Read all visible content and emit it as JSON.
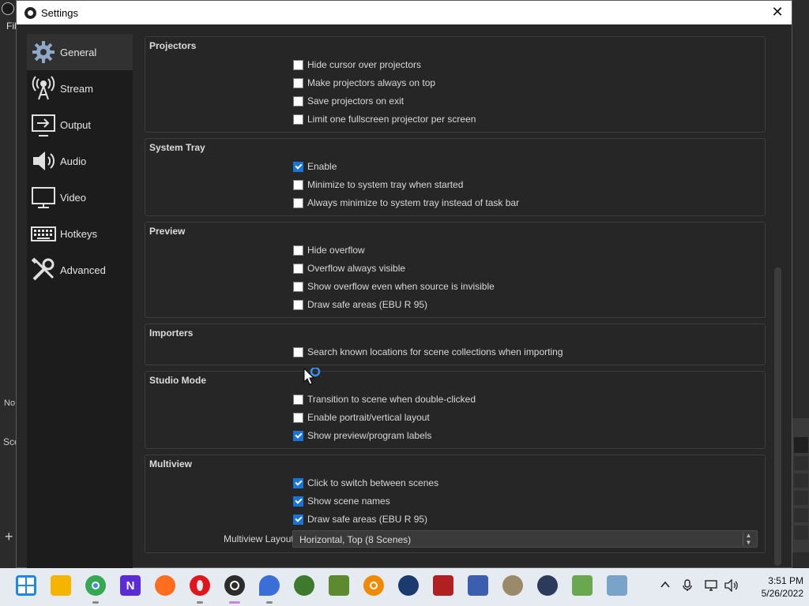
{
  "background": {
    "menu_text": "Fil",
    "no_text": "No",
    "scenes_text": "Sce",
    "add_text": "+"
  },
  "dialog": {
    "title": "Settings",
    "close": "✕"
  },
  "sidebar": {
    "items": [
      {
        "label": "General",
        "icon": "gear-icon",
        "active": true
      },
      {
        "label": "Stream",
        "icon": "broadcast-icon",
        "active": false
      },
      {
        "label": "Output",
        "icon": "output-icon",
        "active": false
      },
      {
        "label": "Audio",
        "icon": "speaker-icon",
        "active": false
      },
      {
        "label": "Video",
        "icon": "monitor-icon",
        "active": false
      },
      {
        "label": "Hotkeys",
        "icon": "keyboard-icon",
        "active": false
      },
      {
        "label": "Advanced",
        "icon": "tools-icon",
        "active": false
      }
    ]
  },
  "sections": {
    "projectors": {
      "title": "Projectors",
      "options": [
        {
          "label": "Hide cursor over projectors",
          "checked": false
        },
        {
          "label": "Make projectors always on top",
          "checked": false
        },
        {
          "label": "Save projectors on exit",
          "checked": false
        },
        {
          "label": "Limit one fullscreen projector per screen",
          "checked": false
        }
      ]
    },
    "system_tray": {
      "title": "System Tray",
      "options": [
        {
          "label": "Enable",
          "checked": true
        },
        {
          "label": "Minimize to system tray when started",
          "checked": false
        },
        {
          "label": "Always minimize to system tray instead of task bar",
          "checked": false
        }
      ]
    },
    "preview": {
      "title": "Preview",
      "options": [
        {
          "label": "Hide overflow",
          "checked": false
        },
        {
          "label": "Overflow always visible",
          "checked": false
        },
        {
          "label": "Show overflow even when source is invisible",
          "checked": false
        },
        {
          "label": "Draw safe areas (EBU R 95)",
          "checked": false
        }
      ]
    },
    "importers": {
      "title": "Importers",
      "options": [
        {
          "label": "Search known locations for scene collections when importing",
          "checked": false
        }
      ]
    },
    "studio_mode": {
      "title": "Studio Mode",
      "options": [
        {
          "label": "Transition to scene when double-clicked",
          "checked": false
        },
        {
          "label": "Enable portrait/vertical layout",
          "checked": false
        },
        {
          "label": "Show preview/program labels",
          "checked": true
        }
      ]
    },
    "multiview": {
      "title": "Multiview",
      "options": [
        {
          "label": "Click to switch between scenes",
          "checked": true
        },
        {
          "label": "Show scene names",
          "checked": true
        },
        {
          "label": "Draw safe areas (EBU R 95)",
          "checked": true
        }
      ],
      "layout_label": "Multiview Layout",
      "layout_value": "Horizontal, Top (8 Scenes)"
    }
  },
  "taskbar": {
    "apps": [
      {
        "name": "windows-start-icon",
        "color": "#1e88e5"
      },
      {
        "name": "file-explorer-icon",
        "color": "#f4b400"
      },
      {
        "name": "chrome-icon",
        "color": "#34a853"
      },
      {
        "name": "n-app-icon",
        "color": "#5b2bd6",
        "text": "N"
      },
      {
        "name": "firefox-icon",
        "color": "#ff6d1f"
      },
      {
        "name": "opera-icon",
        "color": "#e0161c"
      },
      {
        "name": "obs-icon",
        "color": "#2c2c2c"
      },
      {
        "name": "drop-icon",
        "color": "#3a6fd8"
      },
      {
        "name": "tree-icon",
        "color": "#3d7a2e"
      },
      {
        "name": "minecraft-icon",
        "color": "#5d8a2f"
      },
      {
        "name": "magnifier-icon",
        "color": "#f08a00"
      },
      {
        "name": "steam-icon",
        "color": "#1b3b6f"
      },
      {
        "name": "bug-icon",
        "color": "#b02020"
      },
      {
        "name": "network-drive-icon",
        "color": "#3b5fae"
      },
      {
        "name": "disc-icon",
        "color": "#9a8a6a"
      },
      {
        "name": "badge-icon",
        "color": "#2c3a5c"
      },
      {
        "name": "notepad-icon",
        "color": "#6aa84f"
      },
      {
        "name": "printer-icon",
        "color": "#7aa3c9"
      }
    ],
    "time": "3:51 PM",
    "date": "5/26/2022"
  },
  "colors": {
    "accent": "#1a73d6",
    "dialog_bg": "#272727",
    "sidebar_bg": "#1c1c1c"
  }
}
